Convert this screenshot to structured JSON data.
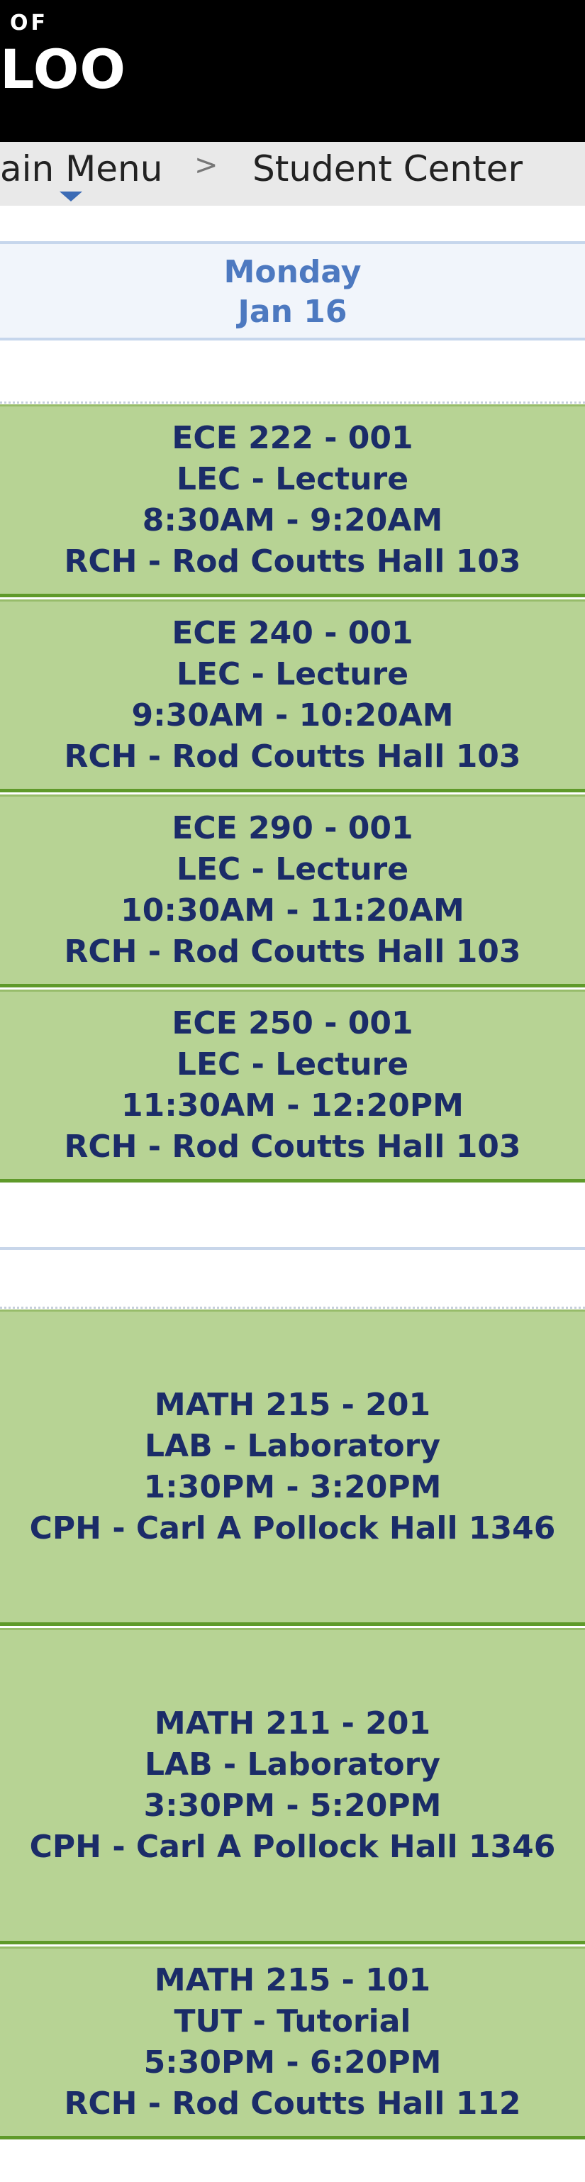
{
  "header": {
    "logo_top": "OF",
    "logo_main": "LOO"
  },
  "breadcrumb": {
    "main_menu": "ain Menu",
    "separator": ">",
    "current": "Student Center"
  },
  "day": {
    "name": "Monday",
    "date": "Jan 16"
  },
  "classes": [
    {
      "course": "ECE 222 - 001",
      "component": "LEC - Lecture",
      "time": "8:30AM - 9:20AM",
      "location": "RCH - Rod Coutts Hall 103"
    },
    {
      "course": "ECE 240 - 001",
      "component": "LEC - Lecture",
      "time": "9:30AM - 10:20AM",
      "location": "RCH - Rod Coutts Hall 103"
    },
    {
      "course": "ECE 290 - 001",
      "component": "LEC - Lecture",
      "time": "10:30AM - 11:20AM",
      "location": "RCH - Rod Coutts Hall 103"
    },
    {
      "course": "ECE 250 - 001",
      "component": "LEC - Lecture",
      "time": "11:30AM - 12:20PM",
      "location": "RCH - Rod Coutts Hall 103"
    },
    {
      "course": "MATH 215 - 201",
      "component": "LAB - Laboratory",
      "time": "1:30PM - 3:20PM",
      "location": "CPH - Carl A Pollock Hall 1346"
    },
    {
      "course": "MATH 211 - 201",
      "component": "LAB - Laboratory",
      "time": "3:30PM - 5:20PM",
      "location": "CPH - Carl A Pollock Hall 1346"
    },
    {
      "course": "MATH 215 - 101",
      "component": "TUT - Tutorial",
      "time": "5:30PM - 6:20PM",
      "location": "RCH - Rod Coutts Hall 112"
    }
  ],
  "colors": {
    "header_bg": "#000000",
    "block_bg": "#b7d394",
    "block_border": "#5f9a2a",
    "block_text": "#1b2c68",
    "day_text": "#4d79c0"
  }
}
